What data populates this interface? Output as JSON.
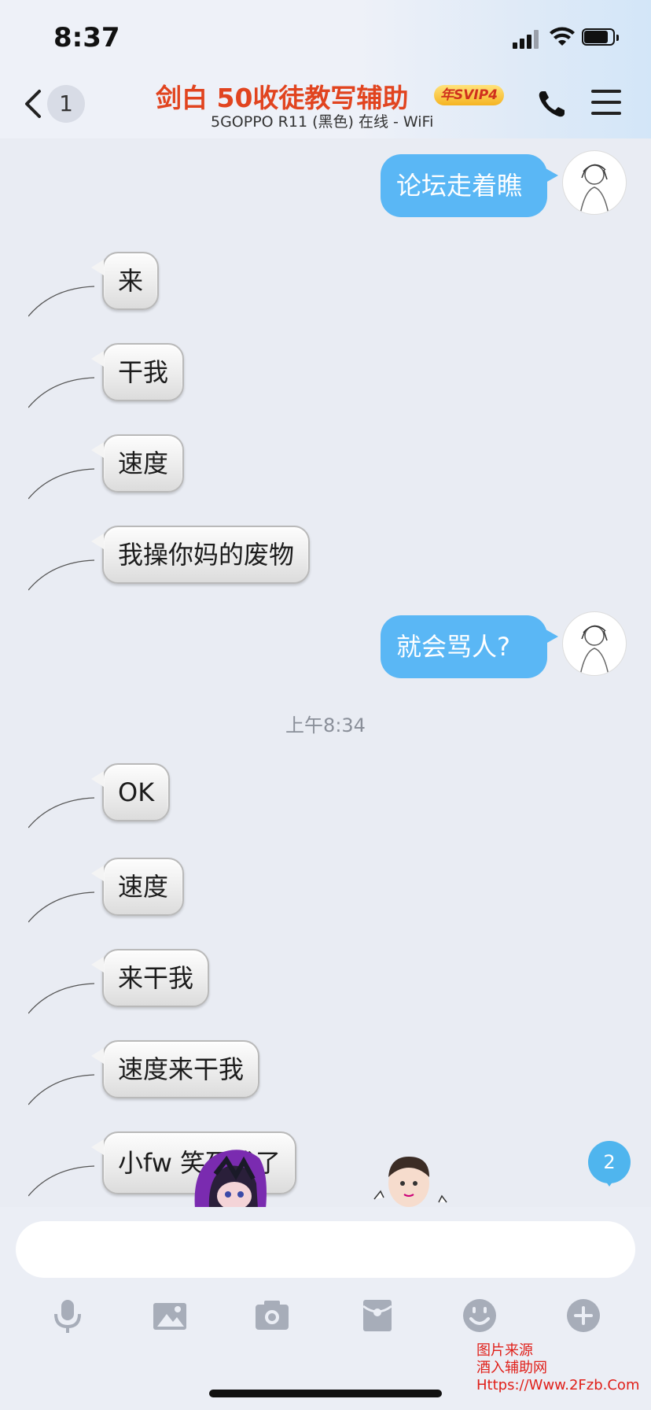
{
  "status_bar": {
    "time": "8:37"
  },
  "header": {
    "back_count": "1",
    "title": "剑白  50收徒教写辅助",
    "vip_badge": "年SVIP4",
    "subtitle": "5GOPPO R11 (黑色) 在线 - WiFi"
  },
  "messages": [
    {
      "side": "out",
      "text": "论坛走着瞧"
    },
    {
      "side": "in",
      "text": "来"
    },
    {
      "side": "in",
      "text": "干我"
    },
    {
      "side": "in",
      "text": "速度"
    },
    {
      "side": "in",
      "text": "我操你妈的废物"
    },
    {
      "side": "out",
      "text": "就会骂人?"
    },
    {
      "side": "in",
      "text": "OK"
    },
    {
      "side": "in",
      "text": "速度"
    },
    {
      "side": "in",
      "text": "来干我"
    },
    {
      "side": "in",
      "text": "速度来干我"
    },
    {
      "side": "in",
      "text": "小fw 笑死我了"
    }
  ],
  "timestamp": "上午8:34",
  "new_message_badge": "2",
  "input": {
    "value": "",
    "placeholder": ""
  },
  "toolbar": [
    "microphone-icon",
    "image-icon",
    "camera-icon",
    "red-packet-icon",
    "emoji-icon",
    "plus-icon"
  ],
  "watermark": {
    "line1": "图片来源",
    "line2": "酒入辅助网",
    "line3": "Https://Www.2Fzb.Com"
  },
  "colors": {
    "accent": "#5ab7f5",
    "title": "#e1441f",
    "background": "#e9ecf3"
  }
}
